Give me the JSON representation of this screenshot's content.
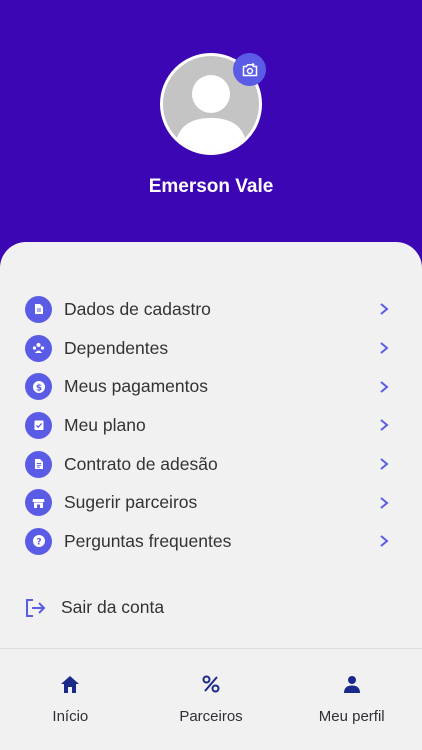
{
  "profile": {
    "name": "Emerson Vale",
    "camera_icon": "camera-icon",
    "avatar_icon": "person-placeholder-icon"
  },
  "menu": {
    "items": [
      {
        "label": "Dados de cadastro",
        "icon": "document-icon"
      },
      {
        "label": "Dependentes",
        "icon": "people-icon"
      },
      {
        "label": "Meus pagamentos",
        "icon": "dollar-icon"
      },
      {
        "label": "Meu plano",
        "icon": "checklist-icon"
      },
      {
        "label": "Contrato de adesão",
        "icon": "contract-icon"
      },
      {
        "label": "Sugerir parceiros",
        "icon": "store-icon"
      },
      {
        "label": "Perguntas frequentes",
        "icon": "question-icon"
      }
    ],
    "logout_label": "Sair da conta"
  },
  "nav": {
    "items": [
      {
        "label": "Início",
        "icon": "home-icon"
      },
      {
        "label": "Parceiros",
        "icon": "percent-icon"
      },
      {
        "label": "Meu perfil",
        "icon": "person-icon"
      }
    ]
  },
  "colors": {
    "header_bg": "#3c06b5",
    "accent": "#5b5ce6",
    "sheet_bg": "#f1f1f2",
    "nav_icon": "#1b2a88"
  }
}
